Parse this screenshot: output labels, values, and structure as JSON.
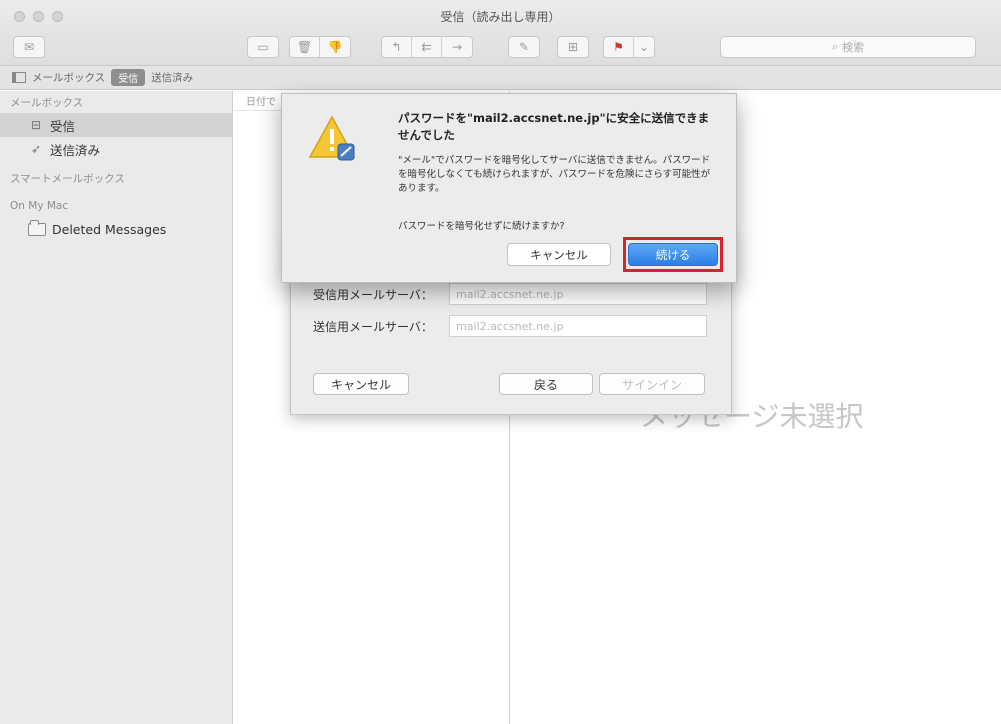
{
  "window": {
    "title": "受信（読み出し専用）"
  },
  "toolbar": {
    "search_placeholder": "検索",
    "search_icon_glyph": "⌕"
  },
  "favorites": {
    "mailbox_label": "メールボックス",
    "inbox_chip": "受信",
    "sent_label": "送信済み"
  },
  "sidebar": {
    "mailboxes_header": "メールボックス",
    "items": [
      {
        "label": "受信",
        "icon": "inbox-icon"
      },
      {
        "label": "送信済み",
        "icon": "paper-plane-icon"
      }
    ],
    "smart_header": "スマートメールボックス",
    "local_header": "On My Mac",
    "local_items": [
      {
        "label": "Deleted Messages",
        "icon": "folder-icon"
      }
    ]
  },
  "message_list": {
    "sort_label": "日付で"
  },
  "viewer": {
    "empty_text": "メッセージ未選択"
  },
  "account_sheet": {
    "incoming_label": "受信用メールサーバ：",
    "incoming_value": "mail2.accsnet.ne.jp",
    "outgoing_label": "送信用メールサーバ：",
    "outgoing_value": "mail2.accsnet.ne.jp",
    "cancel_label": "キャンセル",
    "back_label": "戻る",
    "signin_label": "サインイン"
  },
  "alert": {
    "title": "パスワードを\"mail2.accsnet.ne.jp\"に安全に送信できませんでした",
    "body": "\"メール\"でパスワードを暗号化してサーバに送信できません。パスワードを暗号化しなくても続けられますが、パスワードを危険にさらす可能性があります。",
    "question": "パスワードを暗号化せずに続けますか?",
    "cancel_label": "キャンセル",
    "continue_label": "続ける",
    "highlight_color": "#d8232a",
    "accent_color": "#2a7fe6"
  }
}
